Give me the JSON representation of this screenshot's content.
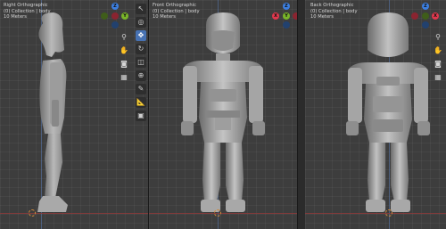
{
  "viewports": [
    {
      "view": "Right Orthographic",
      "collection": "(0) Collection | body",
      "scale": "10 Meters"
    },
    {
      "view": "Front Orthographic",
      "collection": "(0) Collection | body",
      "scale": "10 Meters"
    },
    {
      "view": "Back Orthographic",
      "collection": "(0) Collection | body",
      "scale": "10 Meters"
    }
  ],
  "gizmo": {
    "x": "X",
    "y": "Y",
    "z": "Z"
  },
  "colors": {
    "x_axis": "#e0384d",
    "y_axis": "#79b529",
    "z_axis": "#3c7fe0",
    "active_tool": "#4772b3",
    "floor_line": "#8a3a3a"
  },
  "toolbar_icons": [
    "select-cursor-icon",
    "cursor-icon",
    "move-icon",
    "rotate-icon",
    "scale-icon",
    "transform-icon",
    "annotate-icon",
    "measure-icon",
    "add-cube-icon"
  ],
  "nav_icons": [
    "zoom-icon",
    "pan-hand-icon",
    "camera-icon",
    "grid-icon"
  ]
}
